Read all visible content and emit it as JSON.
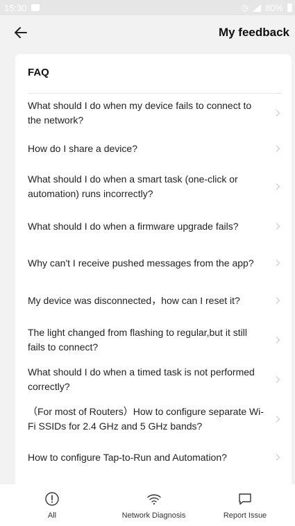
{
  "status_bar": {
    "time": "15:30",
    "battery": "80%"
  },
  "header": {
    "title": "My feedback"
  },
  "faq": {
    "title": "FAQ",
    "items": [
      {
        "text": "What should I do when my device fails to connect to the network?"
      },
      {
        "text": "How do I share a device?"
      },
      {
        "text": "What should I do when a smart task (one-click or automation) runs incorrectly?"
      },
      {
        "text": "What should I do when a firmware upgrade fails?"
      },
      {
        "text": "Why can't I receive pushed messages from the app?"
      },
      {
        "text": "My device was disconnected，how can I reset it?"
      },
      {
        "text": "The light changed from flashing to regular,but it still fails to connect?"
      },
      {
        "text": "What should I do when a timed task is not performed correctly?"
      },
      {
        "text": "（For most of Routers）How to configure separate Wi-Fi SSIDs for 2.4 GHz and 5 GHz bands?"
      },
      {
        "text": "How to configure Tap-to-Run and Automation?"
      }
    ]
  },
  "bottom_nav": {
    "tabs": [
      {
        "label": "All",
        "icon": "info-circle-icon"
      },
      {
        "label": "Network Diagnosis",
        "icon": "wifi-icon"
      },
      {
        "label": "Report Issue",
        "icon": "chat-bubble-icon"
      }
    ]
  }
}
